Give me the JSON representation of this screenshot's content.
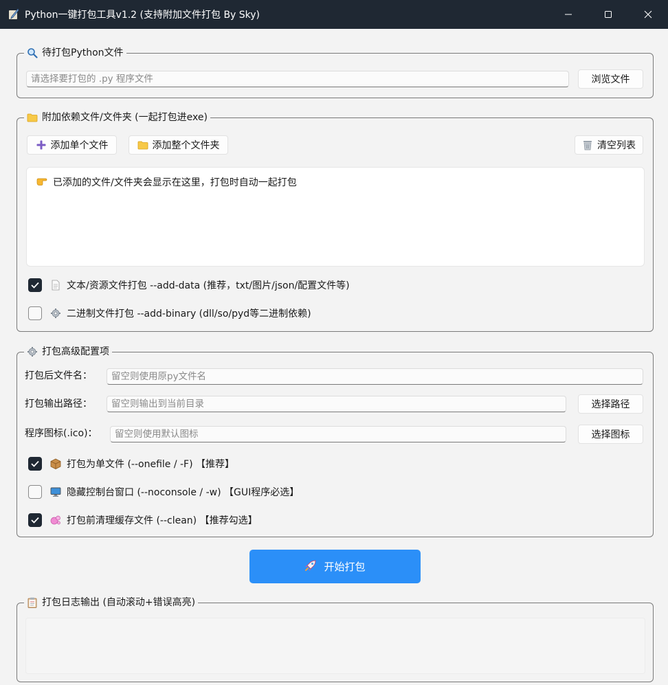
{
  "window": {
    "title": "Python一键打包工具v1.2 (支持附加文件打包 By Sky)",
    "controls": {
      "minimize": "—",
      "maximize": "☐",
      "close": "✕"
    }
  },
  "source_group": {
    "legend": "待打包Python文件",
    "legend_icon": "magnifier-icon",
    "file_input": {
      "value": "",
      "placeholder": "请选择要打包的 .py 程序文件"
    },
    "browse_label": "浏览文件"
  },
  "deps_group": {
    "legend": "附加依赖文件/文件夹 (一起打包进exe)",
    "legend_icon": "folder-icon",
    "add_file_label": "添加单个文件",
    "add_folder_label": "添加整个文件夹",
    "clear_label": "清空列表",
    "list_hint": "已添加的文件/文件夹会显示在这里，打包时自动一起打包",
    "add_data": {
      "label": "文本/资源文件打包 --add-data (推荐，txt/图片/json/配置文件等)",
      "checked": true
    },
    "add_binary": {
      "label": "二进制文件打包 --add-binary (dll/so/pyd等二进制依赖)",
      "checked": false
    }
  },
  "advanced_group": {
    "legend": "打包高级配置项",
    "name_label": "打包后文件名：",
    "name_input": {
      "value": "",
      "placeholder": "留空则使用原py文件名"
    },
    "output_label": "打包输出路径：",
    "output_input": {
      "value": "",
      "placeholder": "留空则输出到当前目录"
    },
    "output_button": "选择路径",
    "icon_label": "程序图标(.ico)：",
    "icon_input": {
      "value": "",
      "placeholder": "留空则使用默认图标"
    },
    "icon_button": "选择图标",
    "onefile": {
      "label": "打包为单文件 (--onefile / -F) 【推荐】",
      "checked": true
    },
    "noconsole": {
      "label": "隐藏控制台窗口 (--noconsole / -w) 【GUI程序必选】",
      "checked": false
    },
    "clean": {
      "label": "打包前清理缓存文件 (--clean) 【推荐勾选】",
      "checked": true
    }
  },
  "start_button": "开始打包",
  "log_group": {
    "legend": "打包日志输出 (自动滚动+错误高亮)",
    "content": ""
  },
  "colors": {
    "titlebar": "#1f2833",
    "accent": "#2b8ff8",
    "checkbox_checked": "#1f2833",
    "background": "#f3f3f3"
  }
}
